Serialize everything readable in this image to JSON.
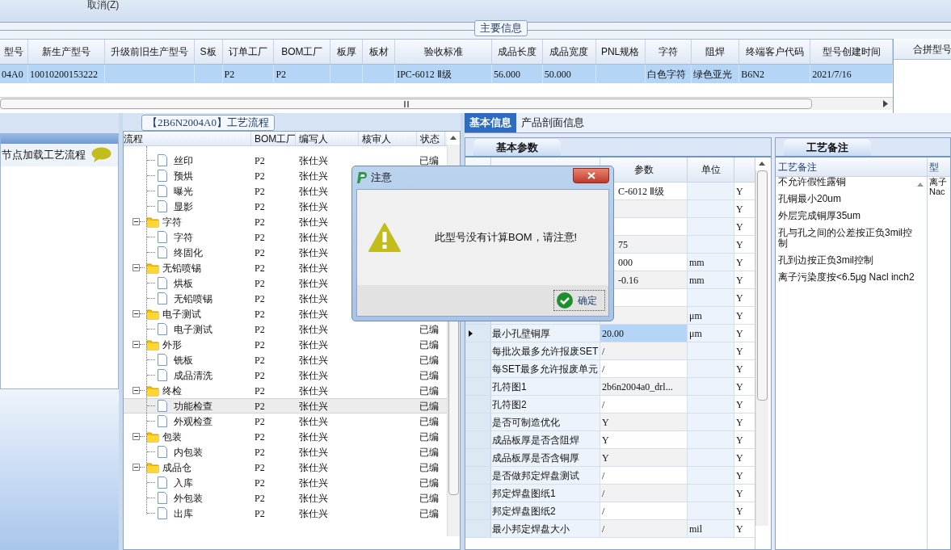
{
  "toolbar": {
    "cancel": "取消(Z)"
  },
  "main_info": {
    "title": "主要信息",
    "columns": [
      "型号",
      "新生产型号",
      "升级前旧生产型号",
      "S板",
      "订单工厂",
      "BOM工厂",
      "板厚",
      "板材",
      "验收标准",
      "成品长度",
      "成品宽度",
      "PNL规格",
      "字符",
      "阻焊",
      "终端客户代码",
      "型号创建时间"
    ],
    "row": {
      "selected": true,
      "cells": [
        "04A0",
        "10010200153222",
        "",
        "",
        "P2",
        "P2",
        "",
        "",
        "IPC-6012 Ⅱ级",
        "56.000",
        "50.000",
        "",
        "白色字符",
        "绿色亚光",
        "B6N2",
        "2021/7/16"
      ]
    },
    "side_header": "合拼型号"
  },
  "left_panel": {
    "hint": "节点加载工艺流程"
  },
  "flow": {
    "title": "【2B6N2004A0】工艺流程",
    "columns": [
      "流程",
      "BOM工厂",
      "编写人",
      "核审人",
      "状态"
    ],
    "items": [
      {
        "kind": "hidden_folder",
        "children": [
          {
            "label": "丝印",
            "bom": "P2",
            "writer": "张仕兴",
            "status": "已编",
            "selected": false
          },
          {
            "label": "预烘",
            "bom": "P2",
            "writer": "张仕兴",
            "selected": false
          },
          {
            "label": "曝光",
            "bom": "P2",
            "writer": "张仕兴",
            "selected": false
          },
          {
            "label": "显影",
            "bom": "P2",
            "writer": "张仕兴",
            "selected": false
          }
        ]
      },
      {
        "kind": "folder",
        "label": "字符",
        "bom": "P2",
        "writer": "张仕兴",
        "selected": false,
        "children": [
          {
            "label": "字符",
            "bom": "P2",
            "writer": "张仕兴",
            "selected": false
          },
          {
            "label": "终固化",
            "bom": "P2",
            "writer": "张仕兴",
            "selected": false
          }
        ]
      },
      {
        "kind": "folder",
        "label": "无铅喷锡",
        "bom": "P2",
        "writer": "张仕兴",
        "selected": false,
        "children": [
          {
            "label": "烘板",
            "bom": "P2",
            "writer": "张仕兴",
            "selected": false
          },
          {
            "label": "无铅喷锡",
            "bom": "P2",
            "writer": "张仕兴",
            "selected": false
          }
        ]
      },
      {
        "kind": "folder",
        "label": "电子测试",
        "bom": "P2",
        "writer": "张仕兴",
        "selected": false,
        "children": [
          {
            "label": "电子测试",
            "bom": "P2",
            "writer": "张仕兴",
            "status": "已编",
            "selected": false
          }
        ]
      },
      {
        "kind": "folder",
        "label": "外形",
        "bom": "P2",
        "writer": "张仕兴",
        "status": "已编",
        "selected": false,
        "children": [
          {
            "label": "铣板",
            "bom": "P2",
            "writer": "张仕兴",
            "status": "已编",
            "selected": false
          },
          {
            "label": "成品清洗",
            "bom": "P2",
            "writer": "张仕兴",
            "status": "已编",
            "selected": false
          }
        ]
      },
      {
        "kind": "folder",
        "label": "终检",
        "bom": "P2",
        "writer": "张仕兴",
        "status": "已编",
        "selected": false,
        "children": [
          {
            "label": "功能检查",
            "bom": "P2",
            "writer": "张仕兴",
            "status": "已编",
            "selected": true
          },
          {
            "label": "外观检查",
            "bom": "P2",
            "writer": "张仕兴",
            "status": "已编",
            "selected": false
          }
        ]
      },
      {
        "kind": "folder",
        "label": "包装",
        "bom": "P2",
        "writer": "张仕兴",
        "status": "已编",
        "selected": false,
        "children": [
          {
            "label": "内包装",
            "bom": "P2",
            "writer": "张仕兴",
            "status": "已编",
            "selected": false
          }
        ]
      },
      {
        "kind": "folder",
        "label": "成品仓",
        "bom": "P2",
        "writer": "张仕兴",
        "status": "已编",
        "selected": false,
        "children": [
          {
            "label": "入库",
            "bom": "P2",
            "writer": "张仕兴",
            "status": "已编",
            "selected": false
          },
          {
            "label": "外包装",
            "bom": "P2",
            "writer": "张仕兴",
            "status": "已编",
            "selected": false
          },
          {
            "label": "出库",
            "bom": "P2",
            "writer": "张仕兴",
            "status": "已编",
            "selected": false
          }
        ]
      }
    ]
  },
  "detail_tabs": [
    {
      "label": "基本信息",
      "selected": true
    },
    {
      "label": "产品剖面信息",
      "selected": false
    }
  ],
  "params": {
    "tab": "基本参数",
    "columns": [
      "参数",
      "单位"
    ],
    "rows": [
      {
        "value": "C-6012 Ⅱ级",
        "flag": "Y",
        "selected": false
      },
      {
        "flag": "Y",
        "selected": false
      },
      {
        "flag": "Y",
        "selected": false
      },
      {
        "value": "75",
        "flag": "Y",
        "selected": false
      },
      {
        "value": "000",
        "unit": "mm",
        "flag": "Y",
        "selected": false
      },
      {
        "value": "-0.16",
        "unit": "mm",
        "flag": "Y",
        "selected": false
      },
      {
        "flag": "Y",
        "selected": false
      },
      {
        "unit": "μm",
        "flag": "Y",
        "selected": false
      },
      {
        "name": "最小孔壁铜厚",
        "value": "20.00",
        "unit": "μm",
        "flag": "Y",
        "selected": true
      },
      {
        "name": "每批次最多允许报废SET",
        "value": "/",
        "flag": "Y",
        "selected": false
      },
      {
        "name": "每SET最多允许报废单元",
        "value": "/",
        "flag": "Y",
        "selected": false
      },
      {
        "name": "孔符图1",
        "value": "2b6n2004a0_drl...",
        "flag": "Y",
        "selected": false
      },
      {
        "name": "孔符图2",
        "value": "/",
        "flag": "Y",
        "selected": false
      },
      {
        "name": "是否可制造优化",
        "value": "Y",
        "flag": "Y",
        "selected": false
      },
      {
        "name": "成品板厚是否含阻焊",
        "value": "Y",
        "flag": "Y",
        "selected": false
      },
      {
        "name": "成品板厚是否含铜厚",
        "value": "Y",
        "flag": "Y",
        "selected": false
      },
      {
        "name": "是否做邦定焊盘测试",
        "value": "/",
        "flag": "Y",
        "selected": false
      },
      {
        "name": "邦定焊盘图纸1",
        "value": "/",
        "flag": "Y",
        "selected": false
      },
      {
        "name": "邦定焊盘图纸2",
        "value": "/",
        "flag": "Y",
        "selected": false
      },
      {
        "name": "最小邦定焊盘大小",
        "value": "/",
        "unit": "mil",
        "flag": "Y",
        "selected": false
      }
    ]
  },
  "notes": {
    "tab": "工艺备注",
    "columns": [
      "工艺备注",
      "型"
    ],
    "items": [
      "不允许假性露铜",
      "孔铜最小20um",
      "外层完成铜厚35um",
      "孔与孔之间的公差按正负3mil控制",
      "孔到边按正负3mil控制",
      "离子污染度按<6.5μg Nacl inch2"
    ],
    "column_2_cell": "离子Nac"
  },
  "dialog": {
    "title": "注意",
    "message": "此型号没有计算BOM，请注意!",
    "ok": "确定"
  }
}
